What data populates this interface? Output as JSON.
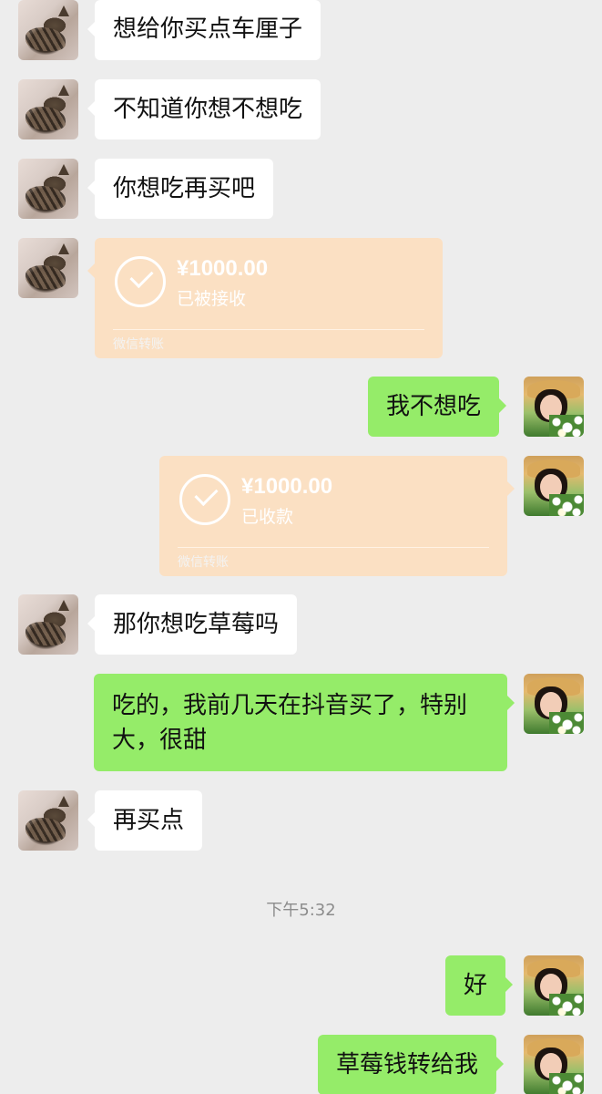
{
  "messages": {
    "m1": "想给你买点车厘子",
    "m2": "不知道你想不想吃",
    "m3": "你想吃再买吧",
    "m4": "我不想吃",
    "m5": "那你想吃草莓吗",
    "m6": "吃的，我前几天在抖音买了，特别大，很甜",
    "m7": "再买点",
    "m8": "好",
    "m9": "草莓钱转给我"
  },
  "transfers": {
    "t1": {
      "amount": "¥1000.00",
      "status": "已被接收",
      "label": "微信转账"
    },
    "t2": {
      "amount": "¥1000.00",
      "status": "已收款",
      "label": "微信转账"
    }
  },
  "timestamp": "下午5:32",
  "colors": {
    "background": "#ededed",
    "bubble_self": "#95ec69",
    "bubble_other": "#ffffff",
    "transfer_bg": "#fbe0c3"
  }
}
